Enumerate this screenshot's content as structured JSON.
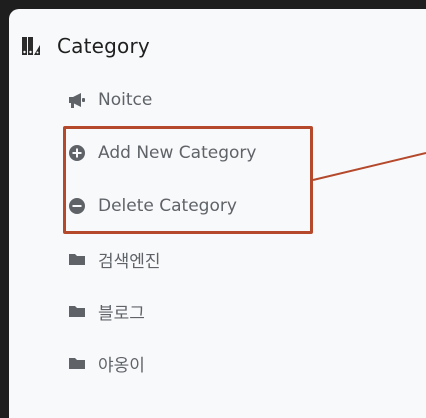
{
  "sidebar": {
    "header": {
      "label": "Category",
      "icon": "category-palette-icon"
    },
    "items": [
      {
        "label": "Noitce",
        "icon": "megaphone-icon"
      },
      {
        "label": "Add New Category",
        "icon": "plus-circle-icon"
      },
      {
        "label": "Delete Category",
        "icon": "minus-circle-icon"
      },
      {
        "label": "검색엔진",
        "icon": "folder-icon"
      },
      {
        "label": "블로그",
        "icon": "folder-icon"
      },
      {
        "label": "야옹이",
        "icon": "folder-icon"
      }
    ]
  },
  "colors": {
    "highlight": "#b4492c",
    "icon": "#5f6368",
    "text": "#5f6368",
    "background": "#f8f9fa",
    "outer": "#1e1e1e"
  }
}
